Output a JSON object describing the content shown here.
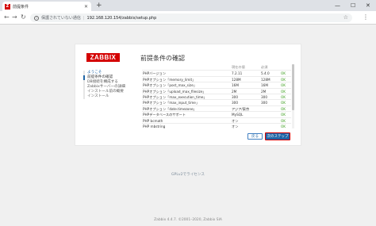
{
  "browser": {
    "tab_title": "前提条件",
    "favicon_letter": "Z",
    "new_tab": "+",
    "minimize": "—",
    "maximize": "☐",
    "close": "✕",
    "not_secure": "保護されていない通信",
    "url": "192.168.120.154/zabbix/setup.php"
  },
  "logo": "ZABBIX",
  "steps": [
    {
      "label": "ようこそ",
      "state": "done"
    },
    {
      "label": "前提条件の確認",
      "state": "active"
    },
    {
      "label": "DB接続を構成する",
      "state": "todo"
    },
    {
      "label": "Zabbixサーバーの詳細",
      "state": "todo"
    },
    {
      "label": "インストール前の概要",
      "state": "todo"
    },
    {
      "label": "インストール",
      "state": "todo"
    }
  ],
  "page_title": "前提条件の確認",
  "table": {
    "headers": [
      "",
      "現在の値",
      "必須",
      ""
    ],
    "rows": [
      [
        "PHPバージョン",
        "7.2.11",
        "5.4.0",
        "OK"
      ],
      [
        "PHPオプション「memory_limit」",
        "128M",
        "128M",
        "OK"
      ],
      [
        "PHPオプション「post_max_size」",
        "16M",
        "16M",
        "OK"
      ],
      [
        "PHPオプション「upload_max_filesize」",
        "2M",
        "2M",
        "OK"
      ],
      [
        "PHPオプション「max_execution_time」",
        "300",
        "300",
        "OK"
      ],
      [
        "PHPオプション「max_input_time」",
        "300",
        "300",
        "OK"
      ],
      [
        "PHPオプション「date.timezone」",
        "アジア/東京",
        "",
        "OK"
      ],
      [
        "PHPデータベースのサポート",
        "MySQL",
        "",
        "OK"
      ],
      [
        "PHP bcmath",
        "オン",
        "",
        "OK"
      ],
      [
        "PHP mbstring",
        "オン",
        "",
        "OK"
      ],
      [
        "PHPオプション「mbstring.func_overload」",
        "オフ",
        "オフ",
        "OK"
      ]
    ]
  },
  "buttons": {
    "back": "戻る",
    "next": "次のステップ"
  },
  "license": "GPLv2でライセンス",
  "footer": "Zabbix 4.4.7. ©2001–2020, Zabbix SIA"
}
